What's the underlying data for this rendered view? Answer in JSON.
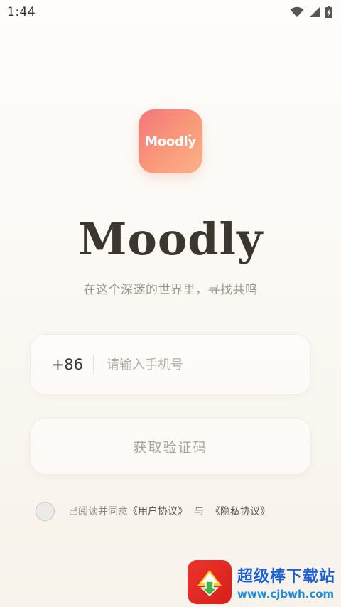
{
  "status_bar": {
    "time": "1:44",
    "icons": [
      "wifi-icon",
      "signal-icon",
      "battery-charging-icon"
    ]
  },
  "app": {
    "icon_text": "Moodly",
    "title": "Moodly",
    "slogan": "在这个深邃的世界里，寻找共鸣"
  },
  "login": {
    "country_code": "+86",
    "phone_placeholder": "请输入手机号",
    "get_code_label": "获取验证码"
  },
  "agreement": {
    "prefix": "已阅读并同意",
    "user_agreement": "《用户协议》",
    "conjunction": "与",
    "privacy_policy": "《隐私协议》"
  },
  "watermark": {
    "title": "超级棒下载站",
    "url": "www.cjbwh.com"
  },
  "colors": {
    "accent_gradient_start": "#f4757a",
    "accent_gradient_end": "#fbb188",
    "watermark_red": "#e9352c",
    "watermark_blue": "#1d5fd6"
  }
}
